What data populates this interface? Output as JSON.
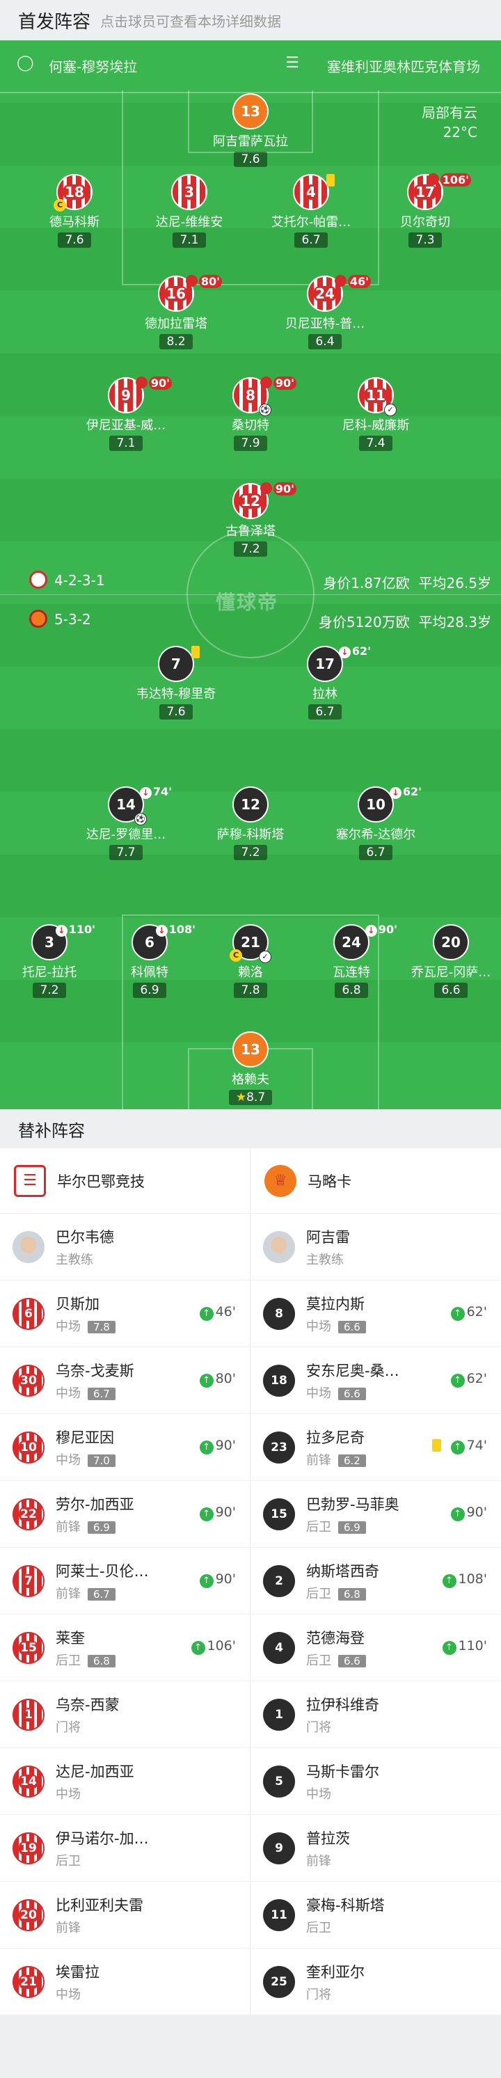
{
  "header": {
    "title": "首发阵容",
    "subtitle": "点击球员可查看本场详细数据"
  },
  "venue": {
    "referee": "何塞-穆努埃拉",
    "stadium": "塞维利亚奥林匹克体育场",
    "weather": "局部有云",
    "temperature": "22°C"
  },
  "home": {
    "formation": "4-2-3-1",
    "value": "身价1.87亿欧",
    "age": "平均26.5岁",
    "players": [
      {
        "num": "13",
        "name": "阿吉雷萨瓦拉",
        "rating": "7.6"
      },
      {
        "num": "18",
        "name": "德马科斯",
        "rating": "7.6"
      },
      {
        "num": "3",
        "name": "达尼-维维安",
        "rating": "7.1"
      },
      {
        "num": "4",
        "name": "艾托尔-帕雷…",
        "rating": "6.7"
      },
      {
        "num": "17",
        "name": "贝尔奇切",
        "rating": "7.3",
        "sub": "106'"
      },
      {
        "num": "16",
        "name": "德加拉雷塔",
        "rating": "8.2",
        "sub": "80'"
      },
      {
        "num": "24",
        "name": "贝尼亚特-普…",
        "rating": "6.4",
        "sub": "46'"
      },
      {
        "num": "9",
        "name": "伊尼亚基-威…",
        "rating": "7.1",
        "sub": "90'"
      },
      {
        "num": "8",
        "name": "桑切特",
        "rating": "7.9",
        "sub": "90'"
      },
      {
        "num": "11",
        "name": "尼科-威廉斯",
        "rating": "7.4"
      },
      {
        "num": "12",
        "name": "古鲁泽塔",
        "rating": "7.2",
        "sub": "90'"
      }
    ]
  },
  "away": {
    "formation": "5-3-2",
    "value": "身价5120万欧",
    "age": "平均28.3岁",
    "players": [
      {
        "num": "7",
        "name": "韦达特-穆里奇",
        "rating": "7.6"
      },
      {
        "num": "17",
        "name": "拉林",
        "rating": "6.7",
        "sub": "62'"
      },
      {
        "num": "14",
        "name": "达尼-罗德里…",
        "rating": "7.7",
        "sub": "74'"
      },
      {
        "num": "12",
        "name": "萨穆-科斯塔",
        "rating": "7.2"
      },
      {
        "num": "10",
        "name": "塞尔希-达德尔",
        "rating": "6.7",
        "sub": "62'"
      },
      {
        "num": "3",
        "name": "托尼-拉托",
        "rating": "7.2",
        "sub": "110'"
      },
      {
        "num": "6",
        "name": "科佩特",
        "rating": "6.9",
        "sub": "108'"
      },
      {
        "num": "21",
        "name": "赖洛",
        "rating": "7.8"
      },
      {
        "num": "24",
        "name": "瓦连特",
        "rating": "6.8",
        "sub": "90'"
      },
      {
        "num": "20",
        "name": "乔瓦尼-冈萨…",
        "rating": "6.6"
      },
      {
        "num": "13",
        "name": "格赖夫",
        "rating": "8.7"
      }
    ]
  },
  "watermark": "懂球帝",
  "subs_title": "替补阵容",
  "clubs": {
    "home": "毕尔巴鄂竞技",
    "away": "马略卡"
  },
  "coaches": {
    "home": "巴尔韦德",
    "away": "阿吉雷",
    "role": "主教练"
  },
  "subs": [
    {
      "h": {
        "num": "6",
        "name": "贝斯加",
        "pos": "中场",
        "rating": "7.8",
        "in": "46'"
      },
      "a": {
        "num": "8",
        "name": "莫拉内斯",
        "pos": "中场",
        "rating": "6.6",
        "in": "62'"
      }
    },
    {
      "h": {
        "num": "30",
        "name": "乌奈-戈麦斯",
        "pos": "中场",
        "rating": "6.7",
        "in": "80'"
      },
      "a": {
        "num": "18",
        "name": "安东尼奥-桑…",
        "pos": "中场",
        "rating": "6.6",
        "in": "62'"
      }
    },
    {
      "h": {
        "num": "10",
        "name": "穆尼亚因",
        "pos": "中场",
        "rating": "7.0",
        "in": "90'"
      },
      "a": {
        "num": "23",
        "name": "拉多尼奇",
        "pos": "前锋",
        "rating": "6.2",
        "in": "74'"
      }
    },
    {
      "h": {
        "num": "22",
        "name": "劳尔-加西亚",
        "pos": "前锋",
        "rating": "6.9",
        "in": "90'"
      },
      "a": {
        "num": "15",
        "name": "巴勃罗-马菲奥",
        "pos": "后卫",
        "rating": "6.9",
        "in": "90'"
      }
    },
    {
      "h": {
        "num": "7",
        "name": "阿莱士-贝伦…",
        "pos": "前锋",
        "rating": "6.7",
        "in": "90'"
      },
      "a": {
        "num": "2",
        "name": "纳斯塔西奇",
        "pos": "后卫",
        "rating": "6.8",
        "in": "108'"
      }
    },
    {
      "h": {
        "num": "15",
        "name": "莱奎",
        "pos": "后卫",
        "rating": "6.8",
        "in": "106'"
      },
      "a": {
        "num": "4",
        "name": "范德海登",
        "pos": "后卫",
        "rating": "6.6",
        "in": "110'"
      }
    },
    {
      "h": {
        "num": "1",
        "name": "乌奈-西蒙",
        "pos": "门将"
      },
      "a": {
        "num": "1",
        "name": "拉伊科维奇",
        "pos": "门将"
      }
    },
    {
      "h": {
        "num": "14",
        "name": "达尼-加西亚",
        "pos": "中场"
      },
      "a": {
        "num": "5",
        "name": "马斯卡雷尔",
        "pos": "中场"
      }
    },
    {
      "h": {
        "num": "19",
        "name": "伊马诺尔-加…",
        "pos": "后卫"
      },
      "a": {
        "num": "9",
        "name": "普拉茨",
        "pos": "前锋"
      }
    },
    {
      "h": {
        "num": "20",
        "name": "比利亚利夫雷",
        "pos": "前锋"
      },
      "a": {
        "num": "11",
        "name": "豪梅-科斯塔",
        "pos": "后卫"
      }
    },
    {
      "h": {
        "num": "21",
        "name": "埃雷拉",
        "pos": "中场"
      },
      "a": {
        "num": "25",
        "name": "奎利亚尔",
        "pos": "门将"
      }
    }
  ],
  "colors": {
    "pitch": "#3bb54f",
    "home": "#d72a2a",
    "away": "#2b2b2b",
    "gk": "#f17a1f"
  }
}
